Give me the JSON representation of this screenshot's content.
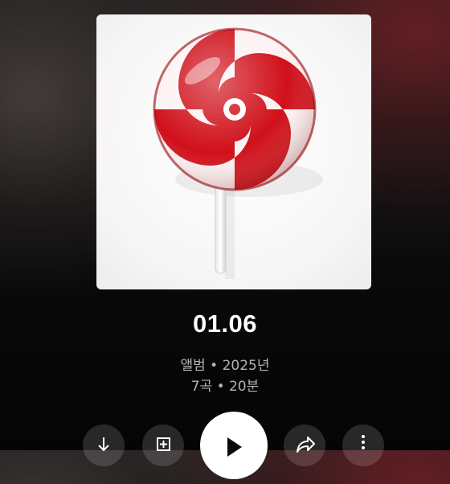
{
  "album": {
    "title": "01.06",
    "type_year": "앨범 • 2025년",
    "tracks_duration": "7곡 • 20분"
  },
  "artwork": {
    "subject": "red and white swirl lollipop",
    "colors": {
      "red": "#d0101a",
      "white": "#ffffff",
      "background": "#f7f5f5"
    }
  },
  "controls": {
    "download_icon": "download-icon",
    "save_icon": "add-to-library-icon",
    "play_icon": "play-icon",
    "share_icon": "share-icon",
    "more_icon": "more-vertical-icon"
  },
  "theme": {
    "accent": "#7a1c22",
    "text_primary": "#ffffff",
    "text_secondary": "#b3b3b3"
  }
}
